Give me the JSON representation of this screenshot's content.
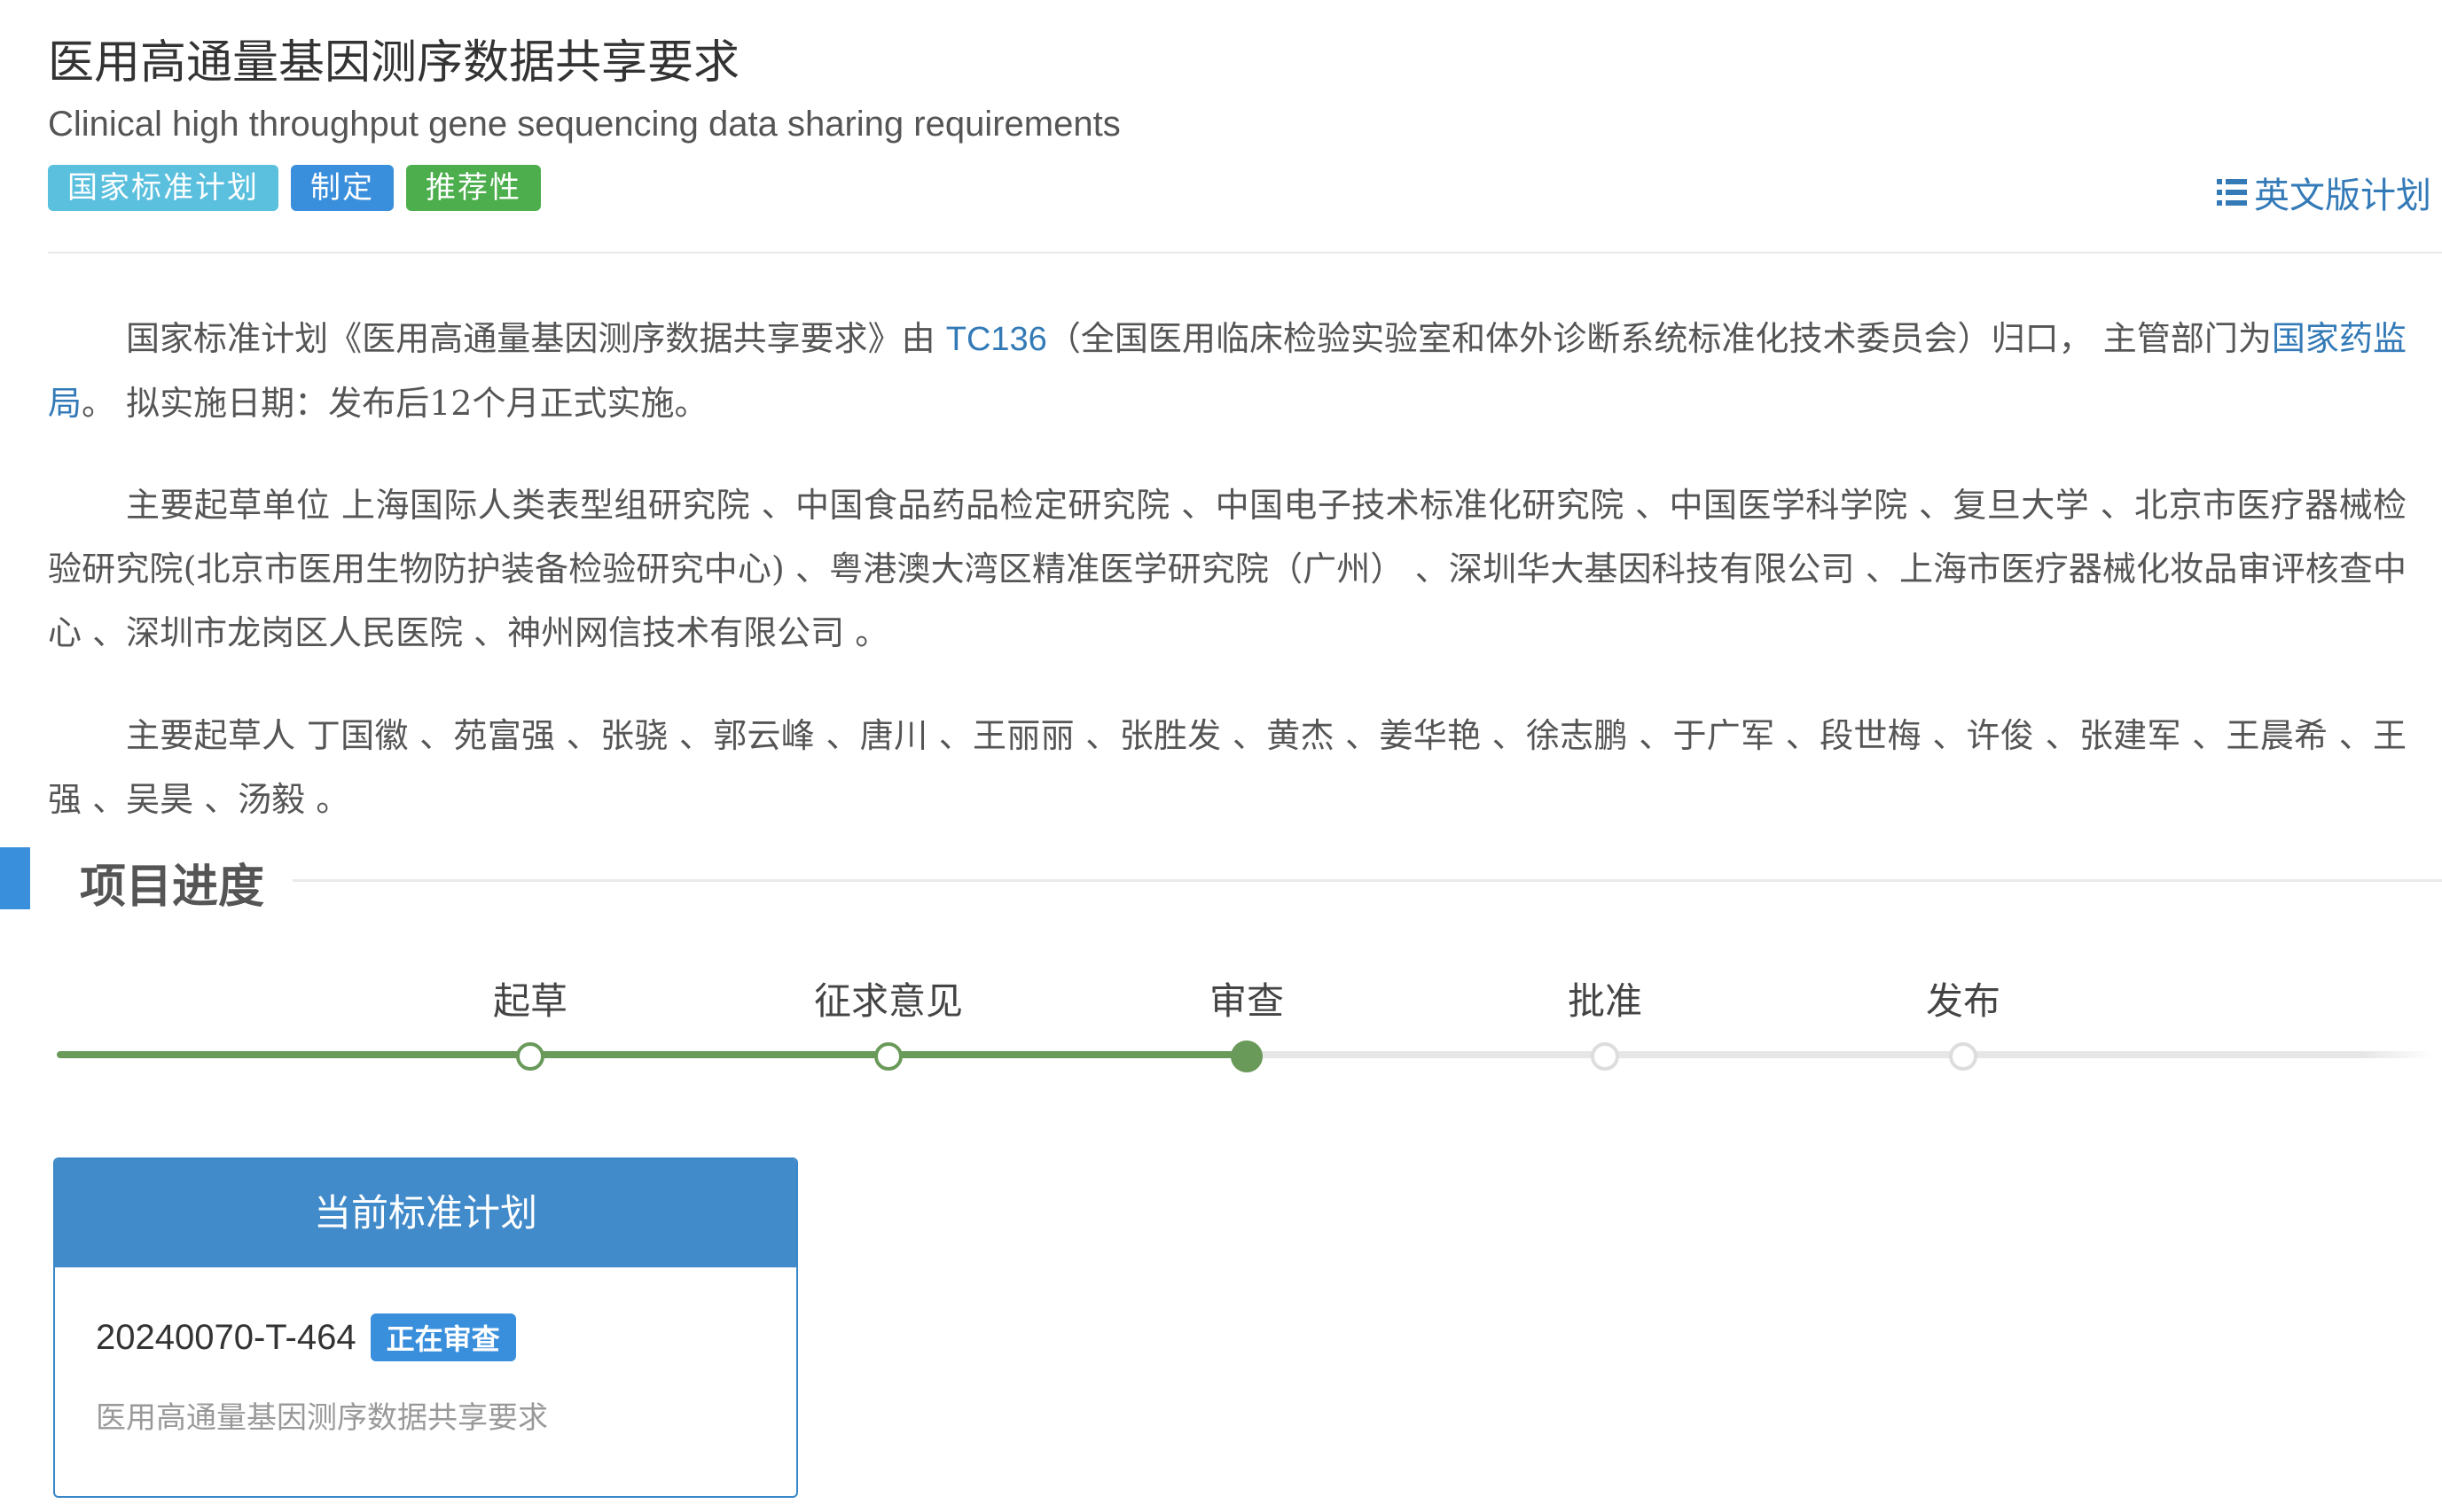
{
  "header": {
    "title_zh": "医用高通量基因测序数据共享要求",
    "title_en": "Clinical high throughput gene sequencing data sharing requirements",
    "tags": {
      "plan": "国家标准计划",
      "formulate": "制定",
      "recommend": "推荐性"
    },
    "english_plan_link": "英文版计划"
  },
  "paragraphs": {
    "p1": {
      "part1": "国家标准计划《医用高通量基因测序数据共享要求》由 ",
      "tc_link": "TC136",
      "part2": "（全国医用临床检验实验室和体外诊断系统标准化技术委员会）归口， 主管部门为",
      "dept_link": "国家药监局",
      "part3": "。 拟实施日期：发布后12个月正式实施。"
    },
    "p2": "主要起草单位 上海国际人类表型组研究院 、中国食品药品检定研究院 、中国电子技术标准化研究院 、中国医学科学院 、复旦大学 、北京市医疗器械检验研究院(北京市医用生物防护装备检验研究中心) 、粤港澳大湾区精准医学研究院（广州） 、深圳华大基因科技有限公司 、上海市医疗器械化妆品审评核查中心 、深圳市龙岗区人民医院 、神州网信技术有限公司 。",
    "p3": "主要起草人 丁国徽 、苑富强 、张骁 、郭云峰 、唐川 、王丽丽 、张胜发 、黄杰 、姜华艳 、徐志鹏 、于广军 、段世梅 、许俊 、张建军 、王晨希 、王强 、吴昊 、汤毅 。"
  },
  "progress": {
    "section_title": "项目进度",
    "steps": [
      {
        "label": "起草",
        "state": "done"
      },
      {
        "label": "征求意见",
        "state": "done"
      },
      {
        "label": "审查",
        "state": "current"
      },
      {
        "label": "批准",
        "state": "todo"
      },
      {
        "label": "发布",
        "state": "todo"
      }
    ]
  },
  "current_plan": {
    "header": "当前标准计划",
    "plan_no": "20240070-T-464",
    "status": "正在审查",
    "name": "医用高通量基因测序数据共享要求"
  },
  "colors": {
    "accent_blue": "#337ab7",
    "progress_green": "#6a9a5a",
    "tag_plan": "#5bc0de",
    "tag_formulate": "#3a8fdc",
    "tag_recommend": "#4cae4c"
  }
}
